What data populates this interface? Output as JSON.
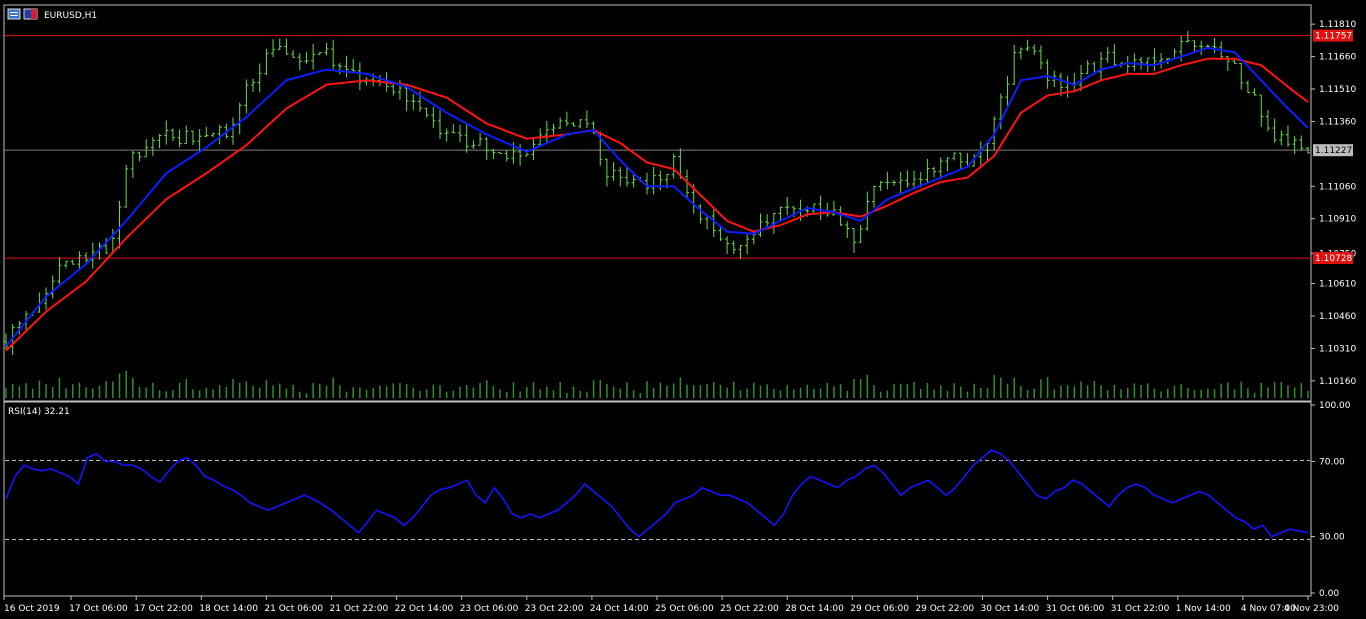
{
  "window": {
    "symbol_label": "EURUSD,H1",
    "rsi_label": "RSI(14) 32.21"
  },
  "colors": {
    "background": "#000000",
    "frame": "#c0c0c0",
    "candles": "#66dd44",
    "volume": "#2f8f2f",
    "ma_fast": "#0a1eff",
    "ma_slow": "#ff1414",
    "hline": "#e01010",
    "bid_line": "#808080",
    "price_tag_red": "#e01010",
    "price_tag_gray": "#bdbdbd",
    "rsi": "#1414ff"
  },
  "chart_data": [
    {
      "type": "candlestick",
      "title": "EURUSD,H1",
      "price_axis_ticks": [
        "1.11810",
        "1.11660",
        "1.11510",
        "1.11360",
        "1.11060",
        "1.10910",
        "1.10750",
        "1.10610",
        "1.10460",
        "1.10310",
        "1.10160"
      ],
      "ylim": [
        1.1009,
        1.1188
      ],
      "time_labels": [
        "16 Oct 2019",
        "17 Oct 06:00",
        "17 Oct 22:00",
        "18 Oct 14:00",
        "21 Oct 06:00",
        "21 Oct 22:00",
        "22 Oct 14:00",
        "23 Oct 06:00",
        "23 Oct 22:00",
        "24 Oct 14:00",
        "25 Oct 06:00",
        "25 Oct 22:00",
        "28 Oct 14:00",
        "29 Oct 06:00",
        "29 Oct 22:00",
        "30 Oct 14:00",
        "31 Oct 06:00",
        "31 Oct 22:00",
        "1 Nov 14:00",
        "4 Nov 07:00",
        "4 Nov 23:00"
      ],
      "horizontal_lines": [
        {
          "price": 1.11757,
          "label": "1.11757",
          "style": "red"
        },
        {
          "price": 1.10728,
          "label": "1.10728",
          "style": "red"
        },
        {
          "price": 1.11227,
          "label": "1.11227",
          "style": "gray"
        }
      ],
      "close_path": [
        [
          0,
          1.1034
        ],
        [
          4,
          1.105
        ],
        [
          8,
          1.1068
        ],
        [
          12,
          1.1072
        ],
        [
          16,
          1.108
        ],
        [
          18,
          1.1115
        ],
        [
          22,
          1.113
        ],
        [
          26,
          1.1128
        ],
        [
          30,
          1.113
        ],
        [
          34,
          1.1132
        ],
        [
          36,
          1.115
        ],
        [
          39,
          1.1165
        ],
        [
          41,
          1.1168
        ],
        [
          44,
          1.1163
        ],
        [
          47,
          1.117
        ],
        [
          50,
          1.116
        ],
        [
          53,
          1.1156
        ],
        [
          56,
          1.1155
        ],
        [
          59,
          1.115
        ],
        [
          62,
          1.1145
        ],
        [
          65,
          1.1132
        ],
        [
          68,
          1.1128
        ],
        [
          71,
          1.1125
        ],
        [
          74,
          1.112
        ],
        [
          77,
          1.112
        ],
        [
          80,
          1.1128
        ],
        [
          83,
          1.1134
        ],
        [
          86,
          1.1138
        ],
        [
          88,
          1.113
        ],
        [
          90,
          1.1112
        ],
        [
          93,
          1.1108
        ],
        [
          96,
          1.1107
        ],
        [
          98,
          1.111
        ],
        [
          100,
          1.1118
        ],
        [
          103,
          1.1098
        ],
        [
          106,
          1.1085
        ],
        [
          108,
          1.1078
        ],
        [
          111,
          1.1082
        ],
        [
          114,
          1.109
        ],
        [
          117,
          1.1096
        ],
        [
          120,
          1.1097
        ],
        [
          123,
          1.1095
        ],
        [
          125,
          1.109
        ],
        [
          127,
          1.108
        ],
        [
          129,
          1.1098
        ],
        [
          131,
          1.111
        ],
        [
          134,
          1.1108
        ],
        [
          137,
          1.111
        ],
        [
          140,
          1.1115
        ],
        [
          142,
          1.112
        ],
        [
          144,
          1.1116
        ],
        [
          146,
          1.112
        ],
        [
          149,
          1.1145
        ],
        [
          151,
          1.1165
        ],
        [
          154,
          1.117
        ],
        [
          156,
          1.1155
        ],
        [
          159,
          1.1152
        ],
        [
          162,
          1.116
        ],
        [
          165,
          1.1165
        ],
        [
          168,
          1.116
        ],
        [
          171,
          1.1165
        ],
        [
          174,
          1.1168
        ],
        [
          177,
          1.1172
        ],
        [
          180,
          1.117
        ],
        [
          183,
          1.1165
        ],
        [
          186,
          1.1152
        ],
        [
          188,
          1.114
        ],
        [
          190,
          1.113
        ],
        [
          193,
          1.1125
        ],
        [
          195,
          1.1123
        ]
      ],
      "ma_fast_path": [
        [
          0,
          1.1032
        ],
        [
          6,
          1.1055
        ],
        [
          12,
          1.107
        ],
        [
          18,
          1.109
        ],
        [
          24,
          1.1112
        ],
        [
          30,
          1.1124
        ],
        [
          36,
          1.1138
        ],
        [
          42,
          1.1155
        ],
        [
          48,
          1.116
        ],
        [
          54,
          1.1158
        ],
        [
          60,
          1.1152
        ],
        [
          66,
          1.114
        ],
        [
          72,
          1.113
        ],
        [
          78,
          1.1122
        ],
        [
          84,
          1.113
        ],
        [
          88,
          1.1132
        ],
        [
          92,
          1.1118
        ],
        [
          96,
          1.1106
        ],
        [
          100,
          1.1106
        ],
        [
          104,
          1.1095
        ],
        [
          108,
          1.1085
        ],
        [
          112,
          1.1084
        ],
        [
          116,
          1.109
        ],
        [
          120,
          1.1096
        ],
        [
          124,
          1.1094
        ],
        [
          128,
          1.109
        ],
        [
          132,
          1.11
        ],
        [
          136,
          1.1105
        ],
        [
          140,
          1.111
        ],
        [
          144,
          1.1115
        ],
        [
          148,
          1.113
        ],
        [
          152,
          1.1155
        ],
        [
          156,
          1.1157
        ],
        [
          160,
          1.1153
        ],
        [
          164,
          1.116
        ],
        [
          168,
          1.1163
        ],
        [
          172,
          1.1162
        ],
        [
          176,
          1.1166
        ],
        [
          180,
          1.117
        ],
        [
          184,
          1.1168
        ],
        [
          188,
          1.1155
        ],
        [
          192,
          1.1142
        ],
        [
          195,
          1.1133
        ]
      ],
      "ma_slow_path": [
        [
          0,
          1.103
        ],
        [
          6,
          1.1048
        ],
        [
          12,
          1.1062
        ],
        [
          18,
          1.1082
        ],
        [
          24,
          1.11
        ],
        [
          30,
          1.1112
        ],
        [
          36,
          1.1125
        ],
        [
          42,
          1.1142
        ],
        [
          48,
          1.1153
        ],
        [
          54,
          1.1155
        ],
        [
          60,
          1.1153
        ],
        [
          66,
          1.1147
        ],
        [
          72,
          1.1135
        ],
        [
          78,
          1.1128
        ],
        [
          84,
          1.113
        ],
        [
          88,
          1.1132
        ],
        [
          92,
          1.1126
        ],
        [
          96,
          1.1117
        ],
        [
          100,
          1.1114
        ],
        [
          104,
          1.1102
        ],
        [
          108,
          1.109
        ],
        [
          112,
          1.1085
        ],
        [
          116,
          1.1088
        ],
        [
          120,
          1.1093
        ],
        [
          124,
          1.1094
        ],
        [
          128,
          1.1092
        ],
        [
          132,
          1.1097
        ],
        [
          136,
          1.1103
        ],
        [
          140,
          1.1108
        ],
        [
          144,
          1.111
        ],
        [
          148,
          1.112
        ],
        [
          152,
          1.114
        ],
        [
          156,
          1.1148
        ],
        [
          160,
          1.115
        ],
        [
          164,
          1.1155
        ],
        [
          168,
          1.1158
        ],
        [
          172,
          1.1158
        ],
        [
          176,
          1.1162
        ],
        [
          180,
          1.1165
        ],
        [
          184,
          1.1165
        ],
        [
          188,
          1.1162
        ],
        [
          192,
          1.1152
        ],
        [
          195,
          1.1145
        ]
      ]
    },
    {
      "type": "line",
      "title": "RSI(14) 32.21",
      "ylim": [
        0,
        100
      ],
      "y_ticks": [
        "100.00",
        "70.00",
        "30.00",
        "0.00"
      ],
      "levels": [
        70,
        30
      ],
      "values": [
        50,
        62,
        68,
        66,
        65,
        66,
        64,
        62,
        58,
        72,
        74,
        70,
        70,
        68,
        68,
        66,
        62,
        59,
        65,
        70,
        72,
        68,
        62,
        60,
        57,
        55,
        52,
        48,
        46,
        44,
        46,
        48,
        50,
        52,
        50,
        47,
        44,
        40,
        36,
        32,
        38,
        44,
        42,
        40,
        36,
        40,
        46,
        52,
        55,
        56,
        58,
        60,
        52,
        48,
        56,
        50,
        42,
        40,
        42,
        40,
        42,
        44,
        48,
        52,
        58,
        54,
        50,
        46,
        40,
        34,
        30,
        34,
        38,
        42,
        48,
        50,
        52,
        56,
        54,
        52,
        52,
        50,
        48,
        44,
        40,
        36,
        42,
        52,
        58,
        62,
        60,
        58,
        56,
        60,
        62,
        66,
        68,
        64,
        58,
        52,
        56,
        58,
        60,
        56,
        52,
        56,
        62,
        68,
        72,
        76,
        74,
        70,
        64,
        58,
        52,
        50,
        54,
        56,
        60,
        58,
        54,
        50,
        46,
        52,
        56,
        58,
        56,
        52,
        50,
        48,
        50,
        52,
        54,
        52,
        48,
        44,
        40,
        38,
        34,
        36,
        30,
        32,
        34,
        33,
        32
      ]
    }
  ]
}
